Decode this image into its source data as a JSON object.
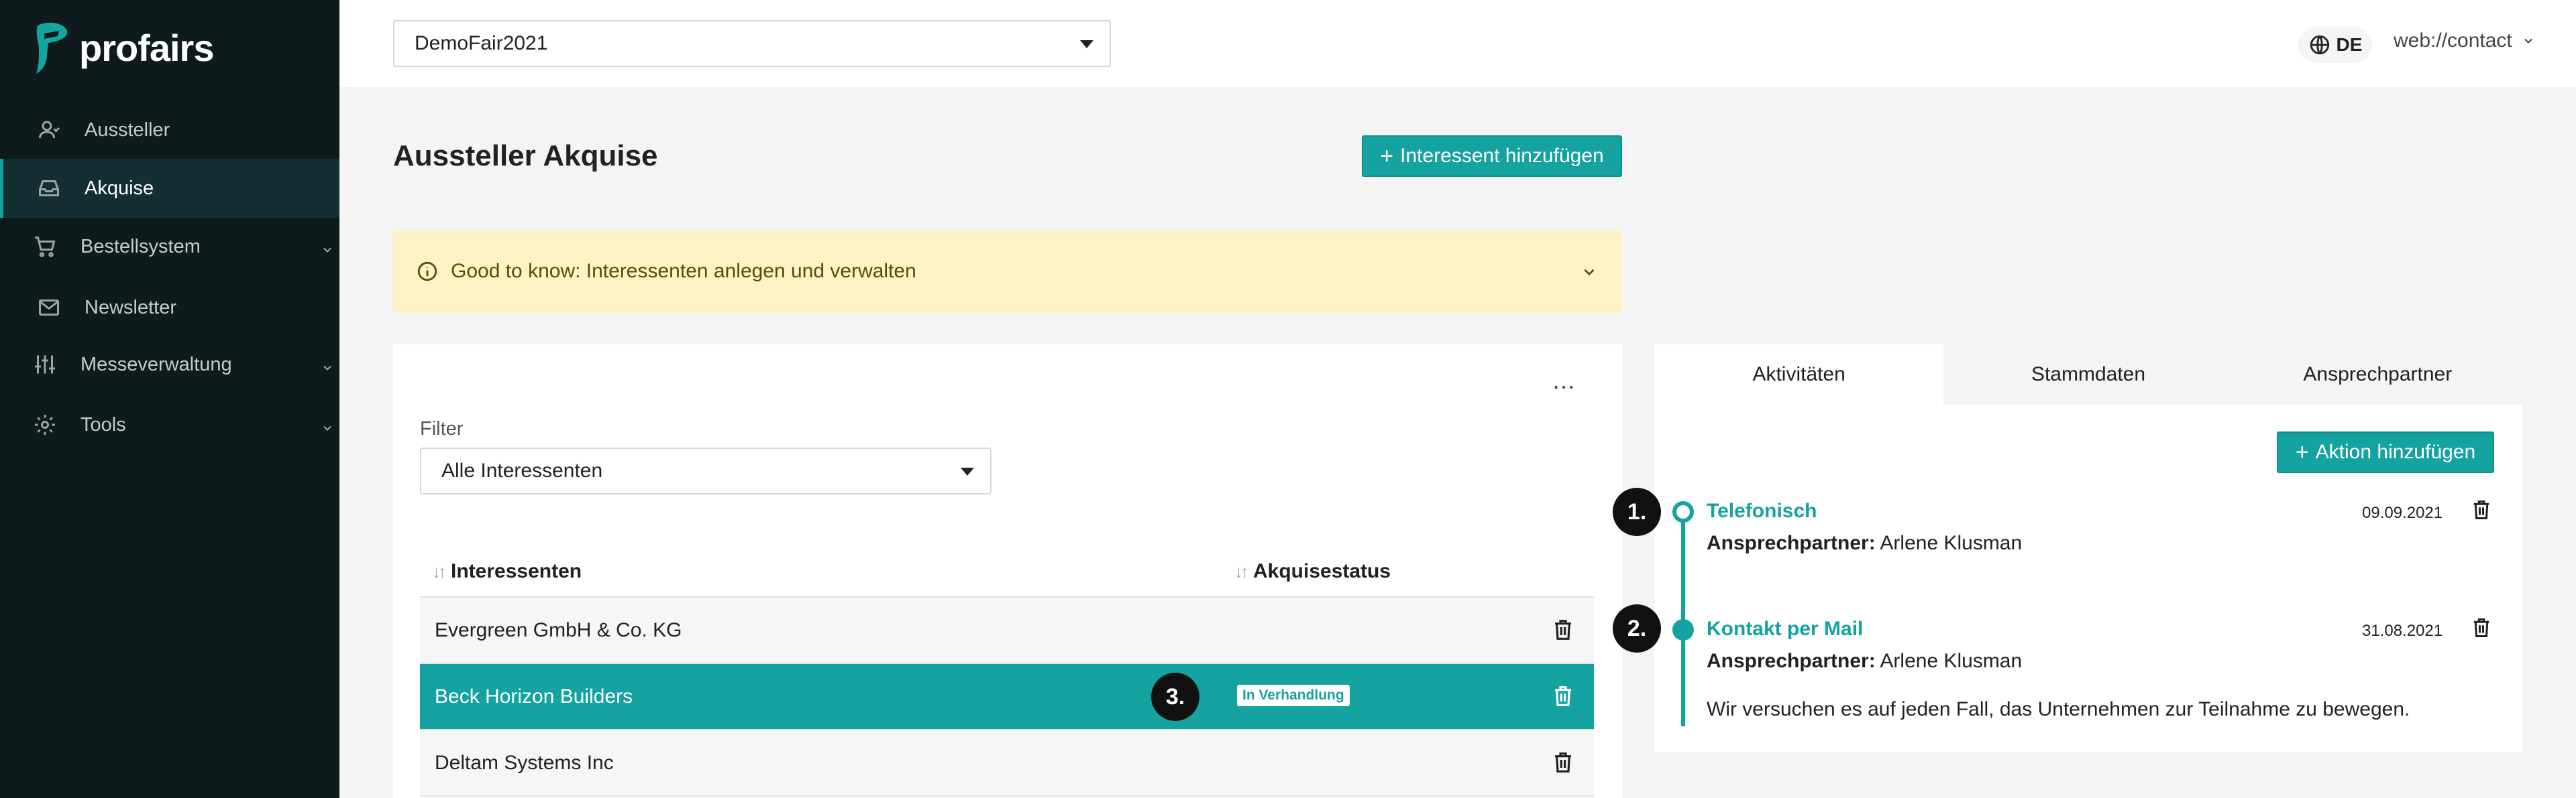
{
  "app": {
    "logo_text": "profairs"
  },
  "sidebar": {
    "items": [
      {
        "label": "Aussteller",
        "icon": "user-icon"
      },
      {
        "label": "Akquise",
        "icon": "inbox-icon"
      },
      {
        "label": "Bestellsystem",
        "icon": "cart-icon"
      },
      {
        "label": "Newsletter",
        "icon": "mail-icon"
      },
      {
        "label": "Messeverwaltung",
        "icon": "sliders-icon"
      },
      {
        "label": "Tools",
        "icon": "gear-icon"
      }
    ]
  },
  "topbar": {
    "fair_select": "DemoFair2021",
    "language": "DE",
    "user": "web://contact"
  },
  "page": {
    "title": "Aussteller Akquise",
    "add_interessent_label": "Interessent hinzufügen",
    "banner_text": "Good to know: Interessenten anlegen und verwalten"
  },
  "list": {
    "filter_label": "Filter",
    "filter_value": "Alle Interessenten",
    "col_name": "Interessenten",
    "col_status": "Akquisestatus",
    "rows": [
      {
        "name": "Evergreen GmbH & Co. KG",
        "status": ""
      },
      {
        "name": "Beck Horizon Builders",
        "status": "In Verhandlung"
      },
      {
        "name": "Deltam Systems Inc",
        "status": ""
      }
    ]
  },
  "tabs": [
    "Aktivitäten",
    "Stammdaten",
    "Ansprechpartner"
  ],
  "activities": {
    "add_label": "Aktion hinzufügen",
    "items": [
      {
        "title": "Telefonisch",
        "date": "09.09.2021",
        "contact_label": "Ansprechpartner:",
        "contact": "Arlene Klusman",
        "note": ""
      },
      {
        "title": "Kontakt per Mail",
        "date": "31.08.2021",
        "contact_label": "Ansprechpartner:",
        "contact": "Arlene Klusman",
        "note": "Wir versuchen es auf jeden Fall, das Unternehmen zur Teilnahme zu bewegen."
      }
    ]
  },
  "steps": [
    "1.",
    "2.",
    "3."
  ],
  "colors": {
    "accent": "#14a3a1",
    "sidebar_bg": "#0f1a1c",
    "banner_bg": "#fef3c7"
  }
}
